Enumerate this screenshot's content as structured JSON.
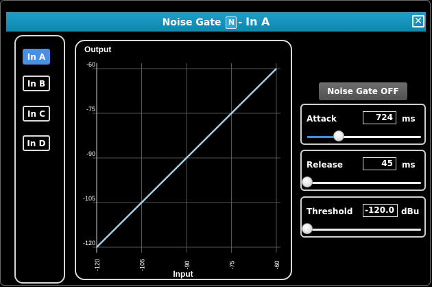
{
  "window": {
    "title": "Noise Gate",
    "badge": "N",
    "separator": "-",
    "channel": "In A",
    "close_glyph": "✕"
  },
  "inputs": [
    {
      "label": "In A",
      "active": true
    },
    {
      "label": "In B",
      "active": false
    },
    {
      "label": "In C",
      "active": false
    },
    {
      "label": "In D",
      "active": false
    }
  ],
  "graph": {
    "ylabel": "Output",
    "xlabel": "Input",
    "y_ticks": [
      "-60",
      "-75",
      "-90",
      "-105",
      "-120"
    ],
    "x_ticks": [
      "-120",
      "-105",
      "-90",
      "-75",
      "-60"
    ],
    "line_color": "#a9cde6",
    "grid_color": "#555555"
  },
  "chart_data": {
    "type": "line",
    "xlabel": "Input",
    "ylabel": "Output",
    "xlim": [
      -120,
      -60
    ],
    "ylim": [
      -120,
      -60
    ],
    "x": [
      -120,
      -60
    ],
    "series": [
      {
        "values": [
          -120,
          -60
        ]
      }
    ]
  },
  "gate_button": {
    "label": "Noise Gate OFF"
  },
  "attack": {
    "label": "Attack",
    "value": "724",
    "unit": "ms",
    "fraction": 0.28
  },
  "release": {
    "label": "Release",
    "value": "45",
    "unit": "ms",
    "fraction": 0.0
  },
  "threshold": {
    "label": "Threshold",
    "value": "-120.0",
    "unit": "dBu",
    "fraction": 0.0
  },
  "colors": {
    "title_bar": "#1393c0",
    "active_input": "#4a8fe3",
    "slider_fill": "#3d8fd6"
  }
}
